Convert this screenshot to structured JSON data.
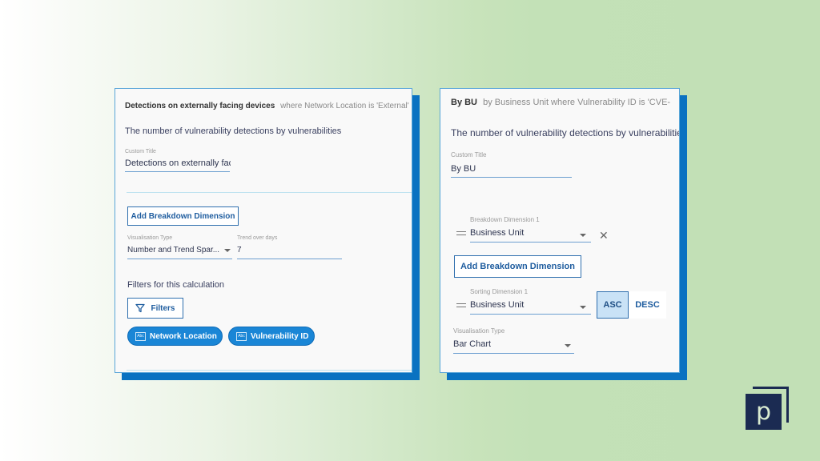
{
  "left_panel": {
    "header_title": "Detections on externally facing devices",
    "header_condition": "where Network Location is 'External'",
    "description": "The number of vulnerability detections by vulnerabilities",
    "custom_title_label": "Custom Title",
    "custom_title_value": "Detections on externally faci",
    "add_breakdown_label": "Add Breakdown Dimension",
    "visualisation_label": "Visualisation Type",
    "visualisation_value": "Number and Trend Spar...",
    "trend_label": "Trend over days",
    "trend_value": "7",
    "filters_heading": "Filters for this calculation",
    "filters_button_label": "Filters",
    "filter_chips": [
      {
        "icon_text": "Abc",
        "label": "Network Location"
      },
      {
        "icon_text": "Abc",
        "label": "Vulnerability ID"
      }
    ]
  },
  "right_panel": {
    "header_title": "By BU",
    "header_condition": "by Business Unit where Vulnerability ID is 'CVE-",
    "description": "The number of vulnerability detections by vulnerabilitie",
    "custom_title_label": "Custom Title",
    "custom_title_value": "By BU",
    "breakdown_label": "Breakdown Dimension 1",
    "breakdown_value": "Business Unit",
    "add_breakdown_label": "Add Breakdown Dimension",
    "sorting_label": "Sorting Dimension 1",
    "sorting_value": "Business Unit",
    "asc_label": "ASC",
    "desc_label": "DESC",
    "visualisation_label": "Visualisation Type",
    "visualisation_value": "Bar Chart"
  },
  "logo": {
    "letter": "p"
  }
}
